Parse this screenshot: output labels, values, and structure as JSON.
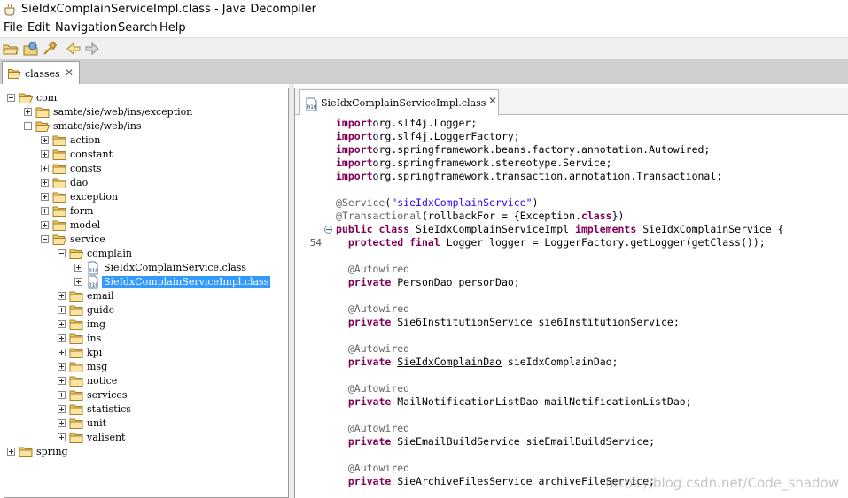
{
  "window": {
    "title": "SieIdxComplainServiceImpl.class - Java Decompiler"
  },
  "menu": [
    "File",
    "Edit",
    "Navigation",
    "Search",
    "Help"
  ],
  "toolbar": {
    "icons": [
      "open-file-icon",
      "open-type-icon",
      "open-type-hierarchy-icon",
      "back-arrow-icon",
      "forward-arrow-icon"
    ]
  },
  "outer_tab": {
    "label": "classes",
    "close": "✕"
  },
  "tree": [
    {
      "label": "com",
      "depth": 0,
      "expander": "minus",
      "icon": "folder-open"
    },
    {
      "label": "samte/sie/web/ins/exception",
      "depth": 1,
      "expander": "plus",
      "icon": "folder"
    },
    {
      "label": "smate/sie/web/ins",
      "depth": 1,
      "expander": "minus",
      "icon": "folder-open"
    },
    {
      "label": "action",
      "depth": 2,
      "expander": "plus",
      "icon": "folder"
    },
    {
      "label": "constant",
      "depth": 2,
      "expander": "plus",
      "icon": "folder"
    },
    {
      "label": "consts",
      "depth": 2,
      "expander": "plus",
      "icon": "folder"
    },
    {
      "label": "dao",
      "depth": 2,
      "expander": "plus",
      "icon": "folder"
    },
    {
      "label": "exception",
      "depth": 2,
      "expander": "plus",
      "icon": "folder"
    },
    {
      "label": "form",
      "depth": 2,
      "expander": "plus",
      "icon": "folder"
    },
    {
      "label": "model",
      "depth": 2,
      "expander": "plus",
      "icon": "folder"
    },
    {
      "label": "service",
      "depth": 2,
      "expander": "minus",
      "icon": "folder-open"
    },
    {
      "label": "complain",
      "depth": 3,
      "expander": "minus",
      "icon": "folder-open"
    },
    {
      "label": "SieIdxComplainService.class",
      "depth": 4,
      "expander": "plus",
      "icon": "class"
    },
    {
      "label": "SieIdxComplainServiceImpl.class",
      "depth": 4,
      "expander": "plus",
      "icon": "class",
      "selected": true
    },
    {
      "label": "email",
      "depth": 3,
      "expander": "plus",
      "icon": "folder"
    },
    {
      "label": "guide",
      "depth": 3,
      "expander": "plus",
      "icon": "folder"
    },
    {
      "label": "img",
      "depth": 3,
      "expander": "plus",
      "icon": "folder"
    },
    {
      "label": "ins",
      "depth": 3,
      "expander": "plus",
      "icon": "folder"
    },
    {
      "label": "kpi",
      "depth": 3,
      "expander": "plus",
      "icon": "folder"
    },
    {
      "label": "msg",
      "depth": 3,
      "expander": "plus",
      "icon": "folder"
    },
    {
      "label": "notice",
      "depth": 3,
      "expander": "plus",
      "icon": "folder"
    },
    {
      "label": "services",
      "depth": 3,
      "expander": "plus",
      "icon": "folder"
    },
    {
      "label": "statistics",
      "depth": 3,
      "expander": "plus",
      "icon": "folder"
    },
    {
      "label": "unit",
      "depth": 3,
      "expander": "plus",
      "icon": "folder"
    },
    {
      "label": "valisent",
      "depth": 3,
      "expander": "plus",
      "icon": "folder"
    },
    {
      "label": "spring",
      "depth": 0,
      "expander": "plus",
      "icon": "folder"
    }
  ],
  "editor": {
    "tab_label": "SieIdxComplainServiceImpl.class",
    "tab_close": "✕",
    "lines": [
      {
        "segs": [
          [
            "k",
            "import"
          ],
          [
            "",
            "org.slf4j.Logger;"
          ]
        ]
      },
      {
        "segs": [
          [
            "k",
            "import"
          ],
          [
            "",
            "org.slf4j.LoggerFactory;"
          ]
        ]
      },
      {
        "segs": [
          [
            "k",
            "import"
          ],
          [
            "",
            "org.springframework.beans.factory.annotation.Autowired;"
          ]
        ]
      },
      {
        "segs": [
          [
            "k",
            "import"
          ],
          [
            "",
            "org.springframework.stereotype.Service;"
          ]
        ]
      },
      {
        "segs": [
          [
            "k",
            "import"
          ],
          [
            "",
            "org.springframework.transaction.annotation.Transactional;"
          ]
        ]
      },
      {
        "segs": []
      },
      {
        "segs": [
          [
            "a",
            "@Service"
          ],
          [
            "",
            "("
          ],
          [
            "s",
            "\"sieIdxComplainService\""
          ],
          [
            "",
            ")"
          ]
        ]
      },
      {
        "segs": [
          [
            "a",
            "@Transactional"
          ],
          [
            "",
            "(rollbackFor = {Exception."
          ],
          [
            "k",
            "class"
          ],
          [
            "",
            "})"
          ]
        ]
      },
      {
        "fold": true,
        "segs": [
          [
            "k",
            "public class"
          ],
          [
            "",
            " SieIdxComplainServiceImpl "
          ],
          [
            "k",
            "implements"
          ],
          [
            "",
            ""
          ],
          [
            "u",
            "SieIdxComplainService"
          ],
          [
            "",
            " {"
          ]
        ]
      },
      {
        "num": "54",
        "segs": [
          [
            "",
            "  "
          ],
          [
            "k",
            "protected final"
          ],
          [
            "",
            " Logger logger = LoggerFactory.getLogger(getClass());"
          ]
        ]
      },
      {
        "segs": []
      },
      {
        "segs": [
          [
            "",
            "  "
          ],
          [
            "a",
            "@Autowired"
          ]
        ]
      },
      {
        "segs": [
          [
            "",
            "  "
          ],
          [
            "k",
            "private"
          ],
          [
            "",
            " PersonDao personDao;"
          ]
        ]
      },
      {
        "segs": []
      },
      {
        "segs": [
          [
            "",
            "  "
          ],
          [
            "a",
            "@Autowired"
          ]
        ]
      },
      {
        "segs": [
          [
            "",
            "  "
          ],
          [
            "k",
            "private"
          ],
          [
            "",
            " Sie6InstitutionService sie6InstitutionService;"
          ]
        ]
      },
      {
        "segs": []
      },
      {
        "segs": [
          [
            "",
            "  "
          ],
          [
            "a",
            "@Autowired"
          ]
        ]
      },
      {
        "segs": [
          [
            "",
            "  "
          ],
          [
            "k",
            "private"
          ],
          [
            "",
            " "
          ],
          [
            "u",
            "SieIdxComplainDao"
          ],
          [
            "",
            " sieIdxComplainDao;"
          ]
        ]
      },
      {
        "segs": []
      },
      {
        "segs": [
          [
            "",
            "  "
          ],
          [
            "a",
            "@Autowired"
          ]
        ]
      },
      {
        "segs": [
          [
            "",
            "  "
          ],
          [
            "k",
            "private"
          ],
          [
            "",
            " MailNotificationListDao mailNotificationListDao;"
          ]
        ]
      },
      {
        "segs": []
      },
      {
        "segs": [
          [
            "",
            "  "
          ],
          [
            "a",
            "@Autowired"
          ]
        ]
      },
      {
        "segs": [
          [
            "",
            "  "
          ],
          [
            "k",
            "private"
          ],
          [
            "",
            " SieEmailBuildService sieEmailBuildService;"
          ]
        ]
      },
      {
        "segs": []
      },
      {
        "segs": [
          [
            "",
            "  "
          ],
          [
            "a",
            "@Autowired"
          ]
        ]
      },
      {
        "segs": [
          [
            "",
            "  "
          ],
          [
            "k",
            "private"
          ],
          [
            "",
            " SieArchiveFilesService archiveFileService;"
          ]
        ]
      }
    ]
  },
  "watermark": "https://blog.csdn.net/Code_shadow"
}
